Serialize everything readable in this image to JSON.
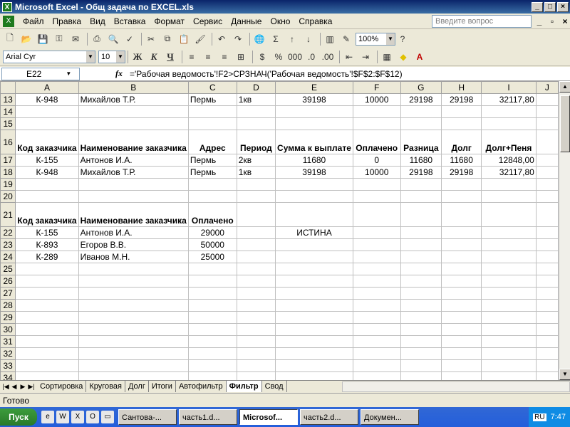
{
  "window": {
    "title": "Microsoft Excel - Общ задача по EXCEL.xls"
  },
  "menu": [
    "Файл",
    "Правка",
    "Вид",
    "Вставка",
    "Формат",
    "Сервис",
    "Данные",
    "Окно",
    "Справка"
  ],
  "help_placeholder": "Введите вопрос",
  "toolbar": {
    "zoom": "100%"
  },
  "format": {
    "font": "Arial Cyr",
    "size": "10",
    "bold": "Ж",
    "italic": "К",
    "underline": "Ч"
  },
  "formula_bar": {
    "name_box": "E22",
    "fx": "fx",
    "formula": "='Рабочая ведомость'!F2>СРЗНАЧ('Рабочая ведомость'!$F$2:$F$12)"
  },
  "columns": [
    "A",
    "B",
    "C",
    "D",
    "E",
    "F",
    "G",
    "H",
    "I",
    "J"
  ],
  "rows": [
    {
      "num": "13",
      "cells": [
        "К-948",
        "Михайлов Т.Р.",
        "Пермь",
        "1кв",
        "39198",
        "10000",
        "29198",
        "29198",
        "32117,80",
        ""
      ]
    },
    {
      "num": "14",
      "cells": [
        "",
        "",
        "",
        "",
        "",
        "",
        "",
        "",
        "",
        ""
      ]
    },
    {
      "num": "15",
      "cells": [
        "",
        "",
        "",
        "",
        "",
        "",
        "",
        "",
        "",
        ""
      ]
    },
    {
      "num": "16",
      "cells": [
        "Код заказчика",
        "Наименование заказчика",
        "Адрес",
        "Период",
        "Сумма к выплате",
        "Оплачено",
        "Разница",
        "Долг",
        "Долг+Пеня",
        ""
      ]
    },
    {
      "num": "17",
      "cells": [
        "К-155",
        "Антонов И.А.",
        "Пермь",
        "2кв",
        "11680",
        "0",
        "11680",
        "11680",
        "12848,00",
        ""
      ]
    },
    {
      "num": "18",
      "cells": [
        "К-948",
        "Михайлов Т.Р.",
        "Пермь",
        "1кв",
        "39198",
        "10000",
        "29198",
        "29198",
        "32117,80",
        ""
      ]
    },
    {
      "num": "19",
      "cells": [
        "",
        "",
        "",
        "",
        "",
        "",
        "",
        "",
        "",
        ""
      ]
    },
    {
      "num": "20",
      "cells": [
        "",
        "",
        "",
        "",
        "",
        "",
        "",
        "",
        "",
        ""
      ]
    },
    {
      "num": "21",
      "cells": [
        "Код заказчика",
        "Наименование заказчика",
        "Оплачено",
        "",
        "",
        "",
        "",
        "",
        "",
        ""
      ]
    },
    {
      "num": "22",
      "cells": [
        "К-155",
        "Антонов И.А.",
        "29000",
        "",
        "ИСТИНА",
        "",
        "",
        "",
        "",
        ""
      ]
    },
    {
      "num": "23",
      "cells": [
        "К-893",
        "Егоров В.В.",
        "50000",
        "",
        "",
        "",
        "",
        "",
        "",
        ""
      ]
    },
    {
      "num": "24",
      "cells": [
        "К-289",
        "Иванов М.Н.",
        "25000",
        "",
        "",
        "",
        "",
        "",
        "",
        ""
      ]
    }
  ],
  "empty_rows": [
    "25",
    "26",
    "27",
    "28",
    "29",
    "30",
    "31",
    "32",
    "33",
    "34"
  ],
  "sheet_tabs": [
    "Сортировка",
    "Круговая",
    "Долг",
    "Итоги",
    "Автофильтр",
    "Фильтр",
    "Свод"
  ],
  "active_tab": "Фильтр",
  "status": "Готово",
  "taskbar": {
    "start": "Пуск",
    "tasks": [
      "Сантова-...",
      "часть1.d...",
      "Microsof...",
      "часть2.d...",
      "Докумен..."
    ],
    "lang": "RU",
    "clock": "7:47"
  }
}
